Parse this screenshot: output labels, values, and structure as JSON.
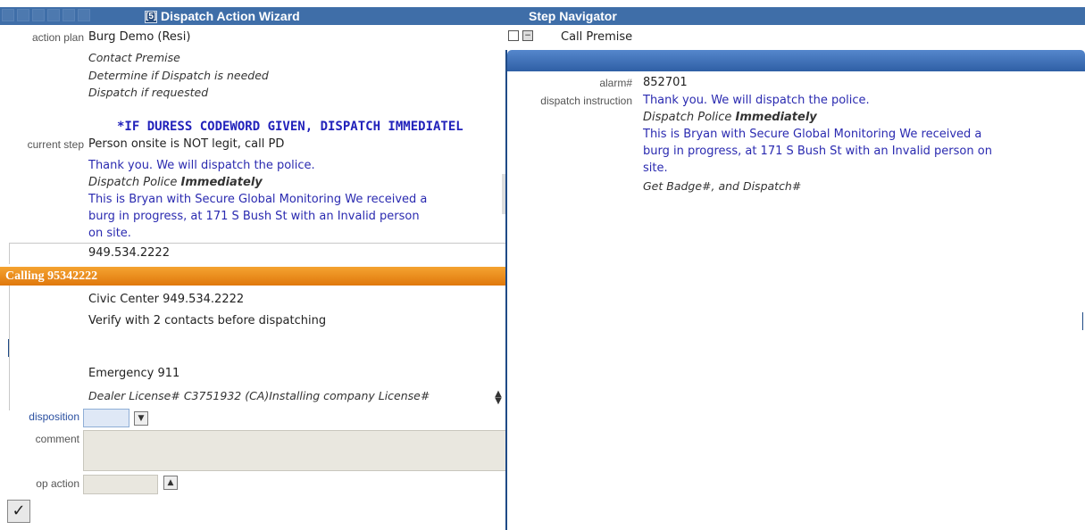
{
  "wizard": {
    "title": "Dispatch Action Wizard",
    "tool_badge": "[5]",
    "action_plan_label": "action plan",
    "action_plan_value": "Burg Demo (Resi)",
    "plan_steps": [
      "Contact Premise",
      "Determine if Dispatch is needed",
      "Dispatch if requested"
    ],
    "duress_notice": "*IF DURESS CODEWORD GIVEN, DISPATCH IMMEDIATEL",
    "current_step_label": "current step",
    "current_step_value": "Person onsite is NOT legit, call PD",
    "step_line1": "Thank you.  We will dispatch the police.",
    "step_line2_prefix": "Dispatch Police ",
    "step_line2_emph": "Immediately",
    "step_line3": "This is Bryan with Secure Global Monitoring We received a",
    "step_line4": "burg in progress, at 171 S Bush St with an Invalid person",
    "step_line5": "on site.",
    "phone": "949.534.2222"
  },
  "calling": {
    "bar_label": "Calling 95342222",
    "contact": "Civic Center 949.534.2222",
    "verify_note": "Verify with 2 contacts before dispatching",
    "emergency": "Emergency 911",
    "license_note": "Dealer License# C3751932 (CA)Installing company License#",
    "disposition_label": "disposition",
    "comment_label": "comment",
    "op_action_label": "op action",
    "submit_icon": "check-icon"
  },
  "navigator": {
    "title": "Step Navigator",
    "step_name": "Call Premise",
    "alarm_label": "alarm#",
    "alarm_value": "852701",
    "instruction_label": "dispatch instruction",
    "instr_line1": "Thank you.  We will dispatch the police.",
    "instr_line2_prefix": "Dispatch Police ",
    "instr_line2_emph": "Immediately",
    "instr_line3": "This is Bryan with Secure Global Monitoring We received a",
    "instr_line4": "burg in progress, at 171 S Bush St with an Invalid person on",
    "instr_line5": "site.",
    "instr_line6": "Get Badge#, and Dispatch#"
  },
  "colors": {
    "titlebar": "#3f6ea8",
    "calling_bar": "#e8870f",
    "link_blue": "#2a2ab0"
  }
}
